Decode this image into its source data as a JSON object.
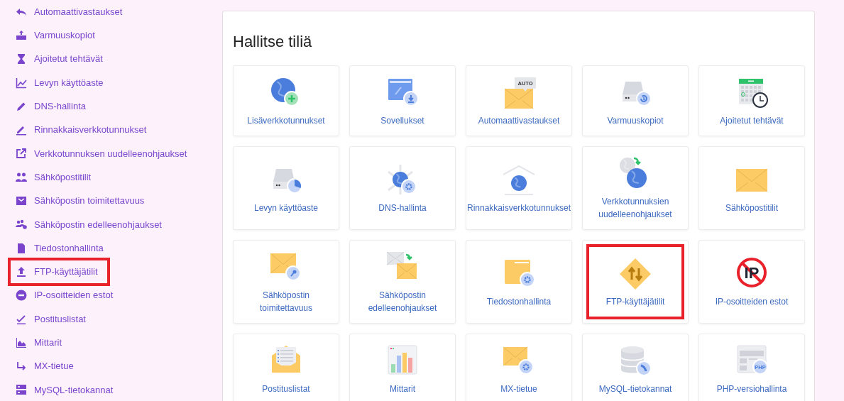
{
  "sidebar": {
    "items": [
      {
        "label": "Automaattivastaukset",
        "highlighted": false
      },
      {
        "label": "Varmuuskopiot",
        "highlighted": false
      },
      {
        "label": "Ajoitetut tehtävät",
        "highlighted": false
      },
      {
        "label": "Levyn käyttöaste",
        "highlighted": false
      },
      {
        "label": "DNS-hallinta",
        "highlighted": false
      },
      {
        "label": "Rinnakkaisverkkotunnukset",
        "highlighted": false
      },
      {
        "label": "Verkkotunnuksen uudelleenohjaukset",
        "highlighted": false
      },
      {
        "label": "Sähköpostitilit",
        "highlighted": false
      },
      {
        "label": "Sähköpostin toimitettavuus",
        "highlighted": false
      },
      {
        "label": "Sähköpostin edelleenohjaukset",
        "highlighted": false
      },
      {
        "label": "Tiedostonhallinta",
        "highlighted": false
      },
      {
        "label": "FTP-käyttäjätilit",
        "highlighted": true
      },
      {
        "label": "IP-osoitteiden estot",
        "highlighted": false
      },
      {
        "label": "Postituslistat",
        "highlighted": false
      },
      {
        "label": "Mittarit",
        "highlighted": false
      },
      {
        "label": "MX-tietue",
        "highlighted": false
      },
      {
        "label": "MySQL-tietokannat",
        "highlighted": false
      }
    ]
  },
  "panel": {
    "title": "Hallitse tiliä",
    "tiles": [
      {
        "label": "Lisäverkkotunnukset",
        "highlighted": false
      },
      {
        "label": "Sovellukset",
        "highlighted": false
      },
      {
        "label": "Automaattivastaukset",
        "highlighted": false,
        "badge": "AUTO"
      },
      {
        "label": "Varmuuskopiot",
        "highlighted": false
      },
      {
        "label": "Ajoitetut tehtävät",
        "highlighted": false
      },
      {
        "label": "Levyn käyttöaste",
        "highlighted": false
      },
      {
        "label": "DNS-hallinta",
        "highlighted": false
      },
      {
        "label": "Rinnakkaisverkkotunnukset",
        "highlighted": false
      },
      {
        "label": "Verkkotunnuksien uudelleenohjaukset",
        "highlighted": false
      },
      {
        "label": "Sähköpostitilit",
        "highlighted": false
      },
      {
        "label": "Sähköpostin toimitettavuus",
        "highlighted": false
      },
      {
        "label": "Sähköpostin edelleenohjaukset",
        "highlighted": false
      },
      {
        "label": "Tiedostonhallinta",
        "highlighted": false
      },
      {
        "label": "FTP-käyttäjätilit",
        "highlighted": true
      },
      {
        "label": "IP-osoitteiden estot",
        "highlighted": false,
        "badge": "IP"
      },
      {
        "label": "Postituslistat",
        "highlighted": false
      },
      {
        "label": "Mittarit",
        "highlighted": false
      },
      {
        "label": "MX-tietue",
        "highlighted": false
      },
      {
        "label": "MySQL-tietokannat",
        "highlighted": false
      },
      {
        "label": "PHP-versiohallinta",
        "highlighted": false,
        "badge": "PHP"
      }
    ]
  }
}
